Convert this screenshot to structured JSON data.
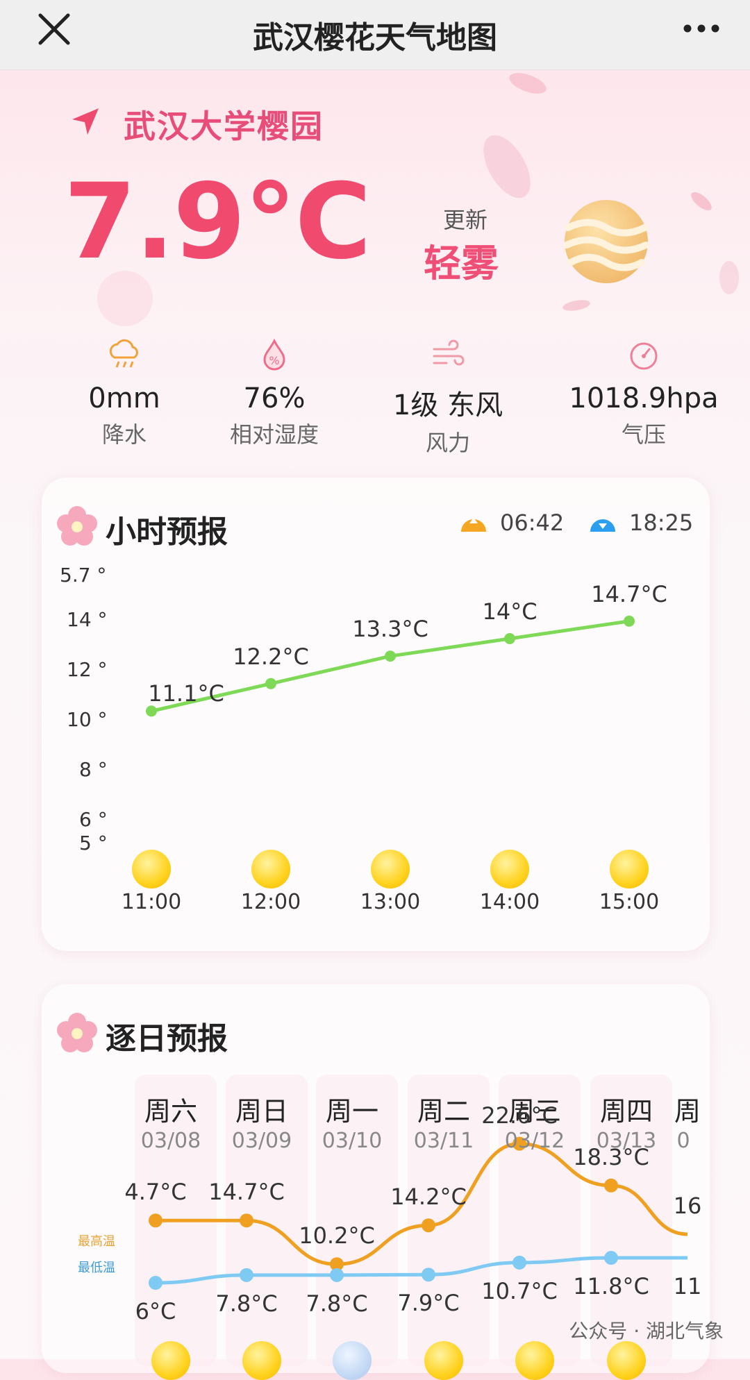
{
  "topbar": {
    "title": "武汉樱花天气地图"
  },
  "location": {
    "name": "武汉大学樱园"
  },
  "current": {
    "temperature": "7.9°C",
    "update_label": "更新",
    "weather": "轻雾"
  },
  "stats": [
    {
      "value": "0mm",
      "label": "降水",
      "icon": "rain-cloud-icon"
    },
    {
      "value": "76%",
      "label": "相对湿度",
      "icon": "humidity-drop-icon"
    },
    {
      "value": "1级 东风",
      "label": "风力",
      "icon": "wind-icon"
    },
    {
      "value": "1018.9hpa",
      "label": "气压",
      "icon": "pressure-gauge-icon"
    }
  ],
  "hourly": {
    "title": "小时预报",
    "sunrise": "06:42",
    "sunset": "18:25",
    "y_ticks": [
      "5.7 °",
      "14 °",
      "12 °",
      "10 °",
      "8 °",
      "6 °",
      "5 °"
    ],
    "point_labels": [
      "11.1°C",
      "12.2°C",
      "13.3°C",
      "14°C",
      "14.7°C"
    ],
    "hours": [
      "11:00",
      "12:00",
      "13:00",
      "14:00",
      "15:00"
    ]
  },
  "daily": {
    "title": "逐日预报",
    "legend_high": "最高温",
    "legend_low": "最低温",
    "days": [
      {
        "name": "周六",
        "date": "03/08",
        "high": "4.7°C",
        "low": "6°C"
      },
      {
        "name": "周日",
        "date": "03/09",
        "high": "14.7°C",
        "low": "7.8°C"
      },
      {
        "name": "周一",
        "date": "03/10",
        "high": "10.2°C",
        "low": "7.8°C"
      },
      {
        "name": "周二",
        "date": "03/11",
        "high": "14.2°C",
        "low": "7.9°C"
      },
      {
        "name": "周三",
        "date": "03/12",
        "high": "22.6°C",
        "low": "10.7°C"
      },
      {
        "name": "周四",
        "date": "03/13",
        "high": "18.3°C",
        "low": "11.8°C"
      },
      {
        "name": "周",
        "date": "0",
        "high": "16",
        "low": "11"
      }
    ]
  },
  "watermark": "公众号 · 湖北气象",
  "chart_data": [
    {
      "type": "line",
      "title": "小时预报",
      "x": [
        "11:00",
        "12:00",
        "13:00",
        "14:00",
        "15:00"
      ],
      "series": [
        {
          "values": [
            11.1,
            12.2,
            13.3,
            14.0,
            14.7
          ]
        }
      ],
      "ylim": [
        5,
        15.7
      ],
      "y_tick_labels": [
        "5.7 °",
        "14 °",
        "12 °",
        "10 °",
        "8 °",
        "6 °",
        "5 °"
      ]
    },
    {
      "type": "line",
      "title": "逐日预报",
      "categories": [
        "03/08",
        "03/09",
        "03/10",
        "03/11",
        "03/12",
        "03/13"
      ],
      "series": [
        {
          "name": "最高温",
          "values": [
            14.7,
            14.7,
            10.2,
            14.2,
            22.6,
            18.3
          ],
          "color": "#f0a020"
        },
        {
          "name": "最低温",
          "values": [
            6.0,
            7.8,
            7.8,
            7.9,
            10.7,
            11.8
          ],
          "color": "#7fcaf3"
        }
      ]
    }
  ]
}
